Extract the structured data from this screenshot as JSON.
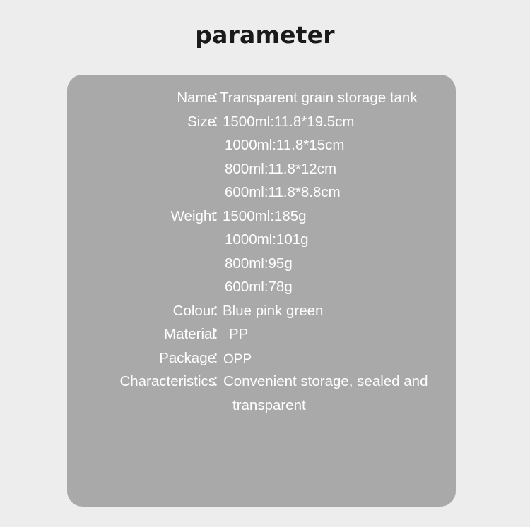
{
  "page": {
    "title": "parameter",
    "background_color": "#ededed",
    "panel_color": "#a9a9a9",
    "text_color": "#ffffff",
    "title_color": "#1a1a1a"
  },
  "spec_panel": {
    "separator": "：",
    "rows": [
      {
        "label": "Name",
        "value": "Transparent grain storage tank"
      },
      {
        "label": "Size",
        "value": "1500ml:11.8*19.5cm"
      },
      {
        "label": "",
        "value": "1000ml:11.8*15cm"
      },
      {
        "label": "",
        "value": "800ml:11.8*12cm"
      },
      {
        "label": "",
        "value": "600ml:11.8*8.8cm"
      },
      {
        "label": "Weight",
        "value": "1500ml:185g"
      },
      {
        "label": "",
        "value": "1000ml:101g"
      },
      {
        "label": "",
        "value": "800ml:95g"
      },
      {
        "label": "",
        "value": "600ml:78g"
      },
      {
        "label": "Colour",
        "value": "Blue pink green"
      },
      {
        "label": "Material",
        "value": "PP"
      },
      {
        "label": "Package",
        "value": "OPP"
      },
      {
        "label": "Characteristics",
        "value": "Convenient storage, sealed and",
        "value_line2": "transparent"
      }
    ]
  }
}
